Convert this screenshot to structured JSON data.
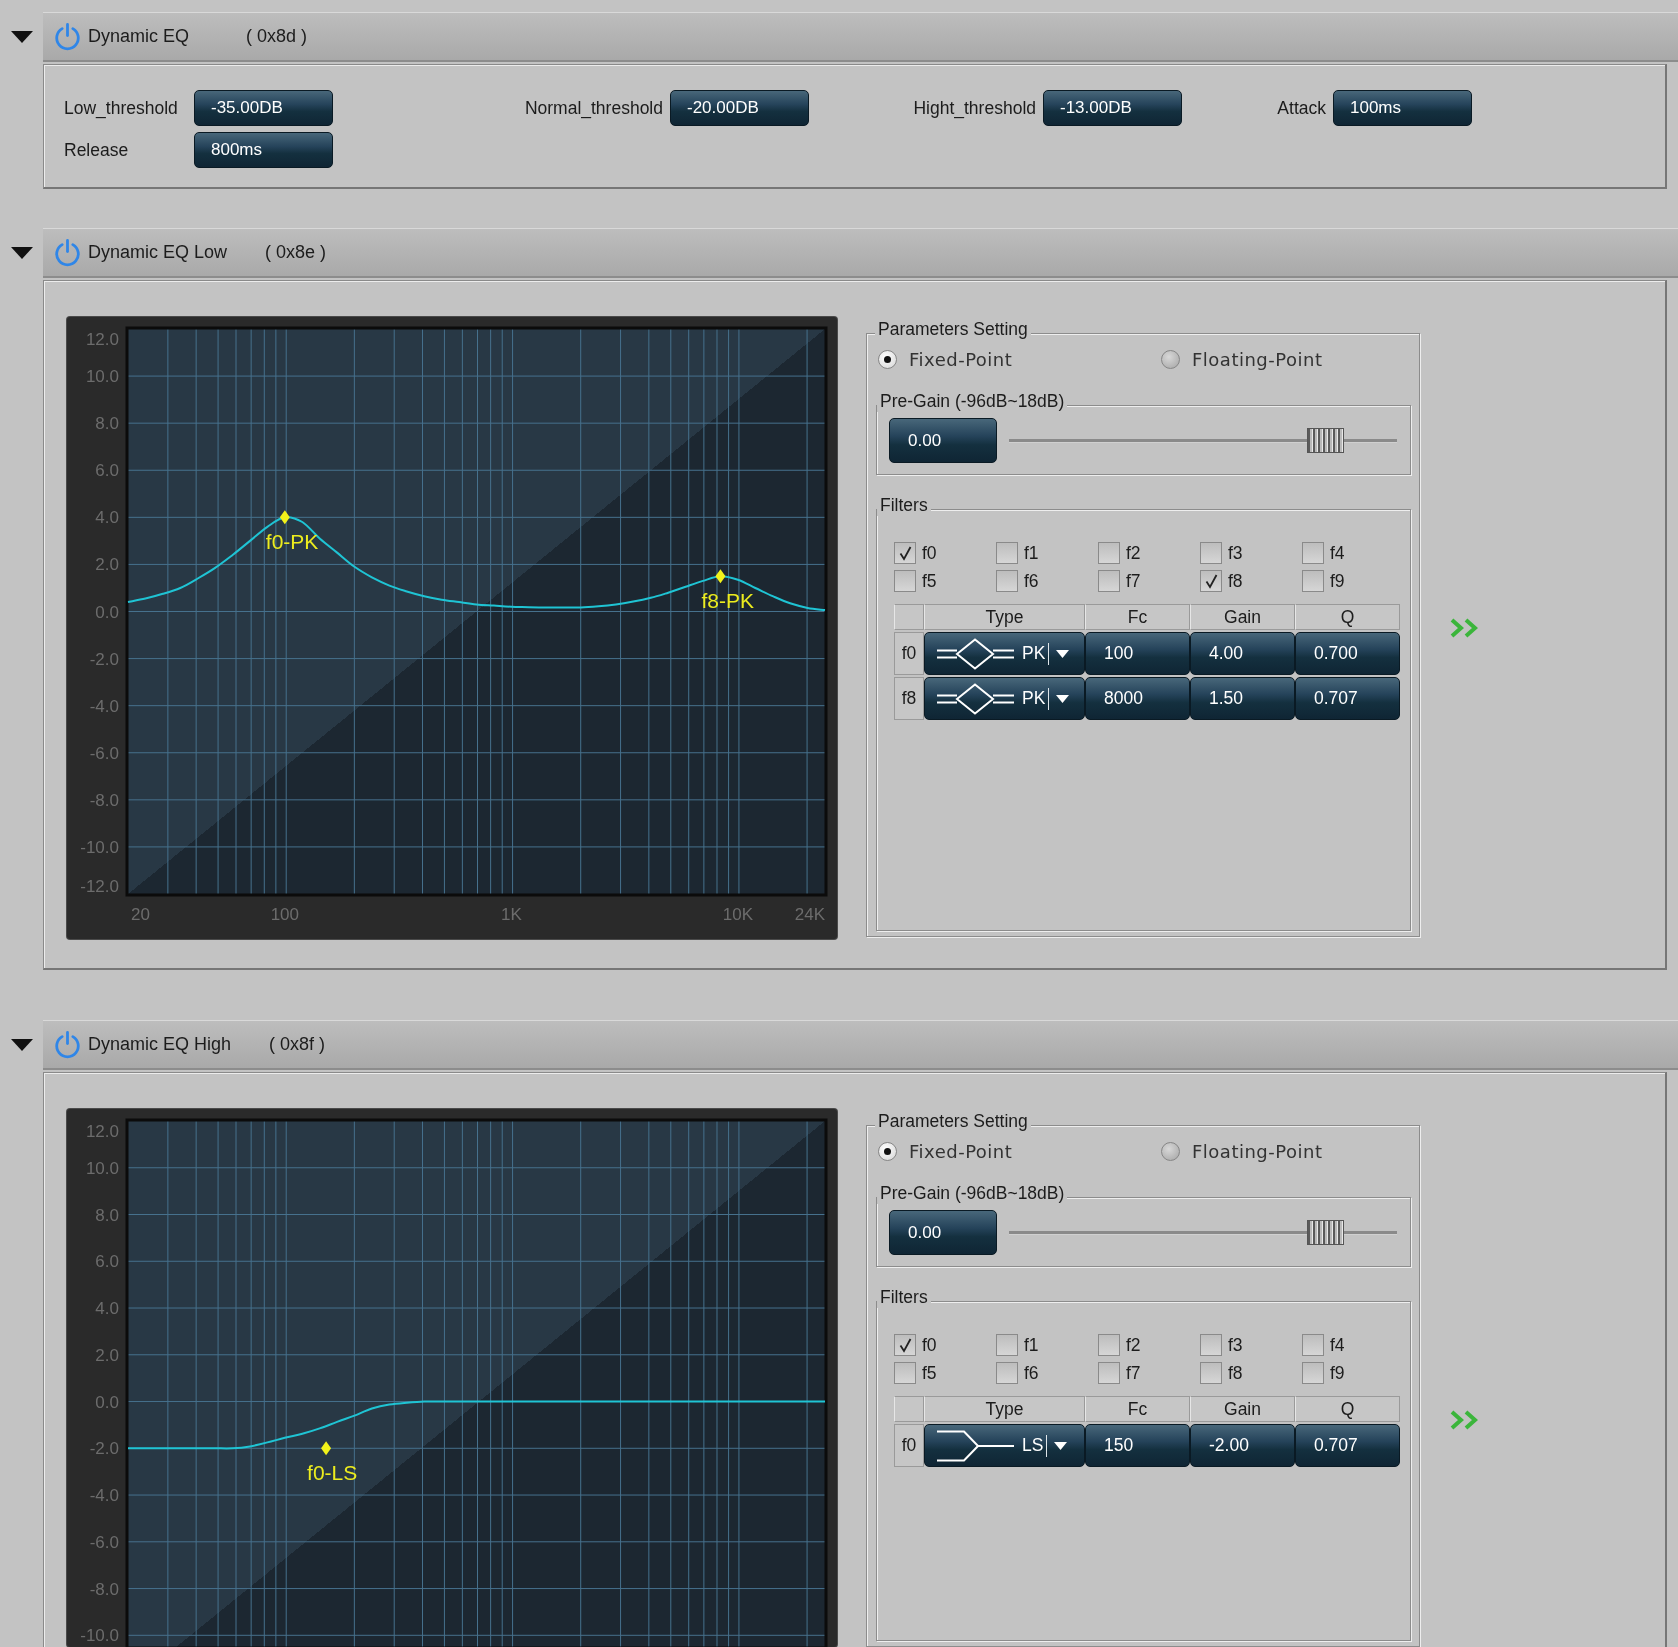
{
  "sections": [
    {
      "kind": "settings",
      "title": "Dynamic EQ",
      "code": "( 0x8d )",
      "expanded": true,
      "on": true,
      "fields": [
        {
          "label": "Low_threshold",
          "value": "-35.00DB"
        },
        {
          "label": "Normal_threshold",
          "value": "-20.00DB"
        },
        {
          "label": "Hight_threshold",
          "value": "-13.00DB"
        },
        {
          "label": "Attack",
          "value": "100ms"
        },
        {
          "label": "Release",
          "value": "800ms"
        }
      ]
    },
    {
      "kind": "eq",
      "title": "Dynamic EQ Low",
      "code": "( 0x8e )",
      "expanded": true,
      "on": true,
      "chart_data": {
        "type": "line",
        "grid": true,
        "ylim": [
          -12,
          12
        ],
        "categories": [
          "20",
          null,
          null,
          null,
          null,
          null,
          null,
          null,
          null,
          "100",
          null,
          null,
          null,
          null,
          null,
          null,
          null,
          null,
          null,
          null,
          null,
          null,
          "1K",
          null,
          null,
          null,
          null,
          null,
          null,
          null,
          null,
          null,
          null,
          null,
          null,
          "10K",
          null,
          null,
          null,
          null,
          "24K"
        ],
        "yticks": [
          {
            "value": 12,
            "label": "12.0"
          },
          {
            "value": 10,
            "label": "10.0"
          },
          {
            "value": 8,
            "label": "8.0"
          },
          {
            "value": 6,
            "label": "6.0"
          },
          {
            "value": 4,
            "label": "4.0"
          },
          {
            "value": 2,
            "label": "2.0"
          },
          {
            "value": 0,
            "label": "0.0"
          },
          {
            "value": -2,
            "label": "-2.0"
          },
          {
            "value": -4,
            "label": "-4.0"
          },
          {
            "value": -6,
            "label": "-6.0"
          },
          {
            "value": -8,
            "label": "-8.0"
          },
          {
            "value": -10,
            "label": "-10.0"
          },
          {
            "value": -12,
            "label": "-12.0"
          }
        ],
        "series": [
          {
            "values": [
              0.4,
              0.55,
              0.75,
              1.0,
              1.4,
              1.85,
              2.4,
              3.0,
              3.6,
              4.0,
              3.8,
              3.1,
              2.5,
              1.9,
              1.45,
              1.1,
              0.85,
              0.65,
              0.5,
              0.4,
              0.3,
              0.25,
              0.2,
              0.18,
              0.17,
              0.17,
              0.17,
              0.22,
              0.3,
              0.42,
              0.58,
              0.8,
              1.05,
              1.3,
              1.5,
              1.35,
              1.0,
              0.65,
              0.35,
              0.15,
              0.06
            ]
          }
        ],
        "annotations": [
          {
            "y": 4,
            "text": "f0-PK"
          },
          {
            "y": 1.5,
            "text": "f8-PK"
          }
        ]
      },
      "parameters": {
        "title": "Parameters Setting",
        "modes": [
          {
            "label": "Fixed-Point",
            "selected": true
          },
          {
            "label": "Floating-Point",
            "selected": false
          }
        ],
        "pre_gain": {
          "title": "Pre-Gain (-96dB~18dB)",
          "value": "0.00",
          "level": 0.85
        },
        "filters": {
          "title": "Filters",
          "items": [
            {
              "label": "f0",
              "checked": true
            },
            {
              "label": "f1",
              "checked": false
            },
            {
              "label": "f2",
              "checked": false
            },
            {
              "label": "f3",
              "checked": false
            },
            {
              "label": "f4",
              "checked": false
            },
            {
              "label": "f5",
              "checked": false
            },
            {
              "label": "f6",
              "checked": false
            },
            {
              "label": "f7",
              "checked": false
            },
            {
              "label": "f8",
              "checked": true
            },
            {
              "label": "f9",
              "checked": false
            }
          ],
          "columns": [
            "Type",
            "Fc",
            "Gain",
            "Q"
          ],
          "rows": [
            {
              "name": "f0",
              "kind": "peak",
              "type": "PK",
              "values": [
                "100",
                "4.00",
                "0.700"
              ]
            },
            {
              "name": "f8",
              "kind": "peak",
              "type": "PK",
              "values": [
                "8000",
                "1.50",
                "0.707"
              ]
            }
          ]
        }
      }
    },
    {
      "kind": "eq",
      "title": "Dynamic EQ High",
      "code": "( 0x8f )",
      "expanded": true,
      "on": true,
      "chart_data": {
        "type": "line",
        "grid": true,
        "ylim": [
          -10.5,
          12
        ],
        "categories": [
          null,
          null,
          null,
          null,
          null,
          null,
          null,
          null,
          null,
          null,
          null,
          null,
          null,
          null,
          null,
          null,
          null,
          null,
          null,
          null,
          null,
          null,
          null,
          null,
          null,
          null,
          null,
          null,
          null,
          null,
          null,
          null,
          null,
          null,
          null,
          null,
          null,
          null,
          null,
          null,
          null
        ],
        "yticks": [
          {
            "value": 12,
            "label": "12.0"
          },
          {
            "value": 10,
            "label": "10.0"
          },
          {
            "value": 8,
            "label": "8.0"
          },
          {
            "value": 6,
            "label": "6.0"
          },
          {
            "value": 4,
            "label": "4.0"
          },
          {
            "value": 2,
            "label": "2.0"
          },
          {
            "value": 0,
            "label": "0.0"
          },
          {
            "value": -2,
            "label": "-2.0"
          },
          {
            "value": -4,
            "label": "-4.0"
          },
          {
            "value": -6,
            "label": "-6.0"
          },
          {
            "value": -8,
            "label": "-8.0"
          },
          {
            "value": -10,
            "label": "-10.0"
          }
        ],
        "series": [
          {
            "values": [
              -2.0,
              -2.0,
              -2.0,
              -2.0,
              -2.0,
              -2.0,
              -2.0,
              -1.92,
              -1.75,
              -1.55,
              -1.38,
              -1.15,
              -0.87,
              -0.6,
              -0.3,
              -0.13,
              -0.05,
              0.0,
              0.0,
              0.0,
              0.0,
              0.0,
              0.0,
              0.0,
              0.0,
              0.0,
              0.0,
              0.0,
              0.0,
              0.0,
              0.0,
              0.0,
              0.0,
              0.0,
              0.0,
              0.0,
              0.0,
              0.0,
              0.0,
              0.0,
              0.0
            ]
          }
        ],
        "annotations": [
          "f0-LS"
        ]
      },
      "parameters": {
        "title": "Parameters Setting",
        "modes": [
          {
            "label": "Fixed-Point",
            "selected": true
          },
          {
            "label": "Floating-Point",
            "selected": false
          }
        ],
        "pre_gain": {
          "title": "Pre-Gain (-96dB~18dB)",
          "value": "0.00",
          "level": 0.85
        },
        "filters": {
          "title": "Filters",
          "items": [
            {
              "label": "f0",
              "checked": true
            },
            {
              "label": "f1",
              "checked": false
            },
            {
              "label": "f2",
              "checked": false
            },
            {
              "label": "f3",
              "checked": false
            },
            {
              "label": "f4",
              "checked": false
            },
            {
              "label": "f5",
              "checked": false
            },
            {
              "label": "f6",
              "checked": false
            },
            {
              "label": "f7",
              "checked": false
            },
            {
              "label": "f8",
              "checked": false
            },
            {
              "label": "f9",
              "checked": false
            }
          ],
          "columns": [
            "Type",
            "Fc",
            "Gain",
            "Q"
          ],
          "rows": [
            {
              "name": "f0",
              "kind": "low_shelf",
              "type": "LS",
              "values": [
                "150",
                "-2.00",
                "0.707"
              ]
            }
          ]
        }
      }
    }
  ]
}
